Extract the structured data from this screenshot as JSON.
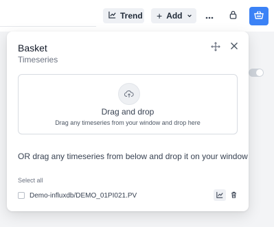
{
  "toolbar": {
    "trend_label": "Trend",
    "add_label": "Add",
    "more_icon": "more-horizontal-icon",
    "lock_icon": "lock-icon",
    "basket_icon": "basket-icon",
    "basket_color": "#3b82f6"
  },
  "panel": {
    "title": "Basket",
    "subtitle": "Timeseries",
    "dropzone": {
      "title": "Drag and drop",
      "subtitle": "Drag any timeseries from your window and drop here"
    },
    "or_text": "OR drag any timeseries from below and drop it on your window",
    "select_all_label": "Select all",
    "items": [
      {
        "label": "Demo-influxdb/DEMO_01PI021.PV",
        "checked": false
      }
    ]
  }
}
